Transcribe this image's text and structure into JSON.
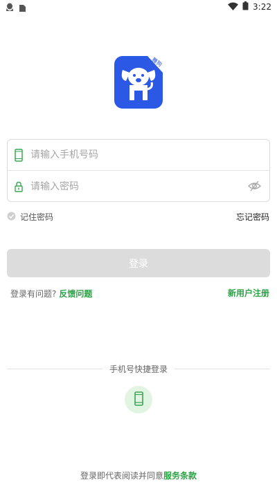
{
  "status_bar": {
    "time": "3:22",
    "left_icons": [
      "qq-icon",
      "sim-card-icon"
    ],
    "right_icons": [
      "wifi-icon",
      "battery-icon"
    ]
  },
  "logo": {
    "badge_text": "舞狗",
    "brand_color": "#2c58e6"
  },
  "form": {
    "phone_placeholder": "请输入手机号码",
    "phone_value": "",
    "password_placeholder": "请输入密码",
    "password_value": ""
  },
  "remember": {
    "label": "记住密码",
    "checked": false
  },
  "forgot_label": "忘记密码",
  "login_button_label": "登录",
  "problem": {
    "text": "登录有问题?",
    "feedback_label": "反馈问题"
  },
  "register_label": "新用户注册",
  "quick_login_label": "手机号快捷登录",
  "agreement": {
    "text": "登录即代表阅读并同意",
    "terms_label": "服务条款"
  },
  "colors": {
    "accent_green": "#2ba245",
    "button_disabled": "#dcdcdc"
  }
}
